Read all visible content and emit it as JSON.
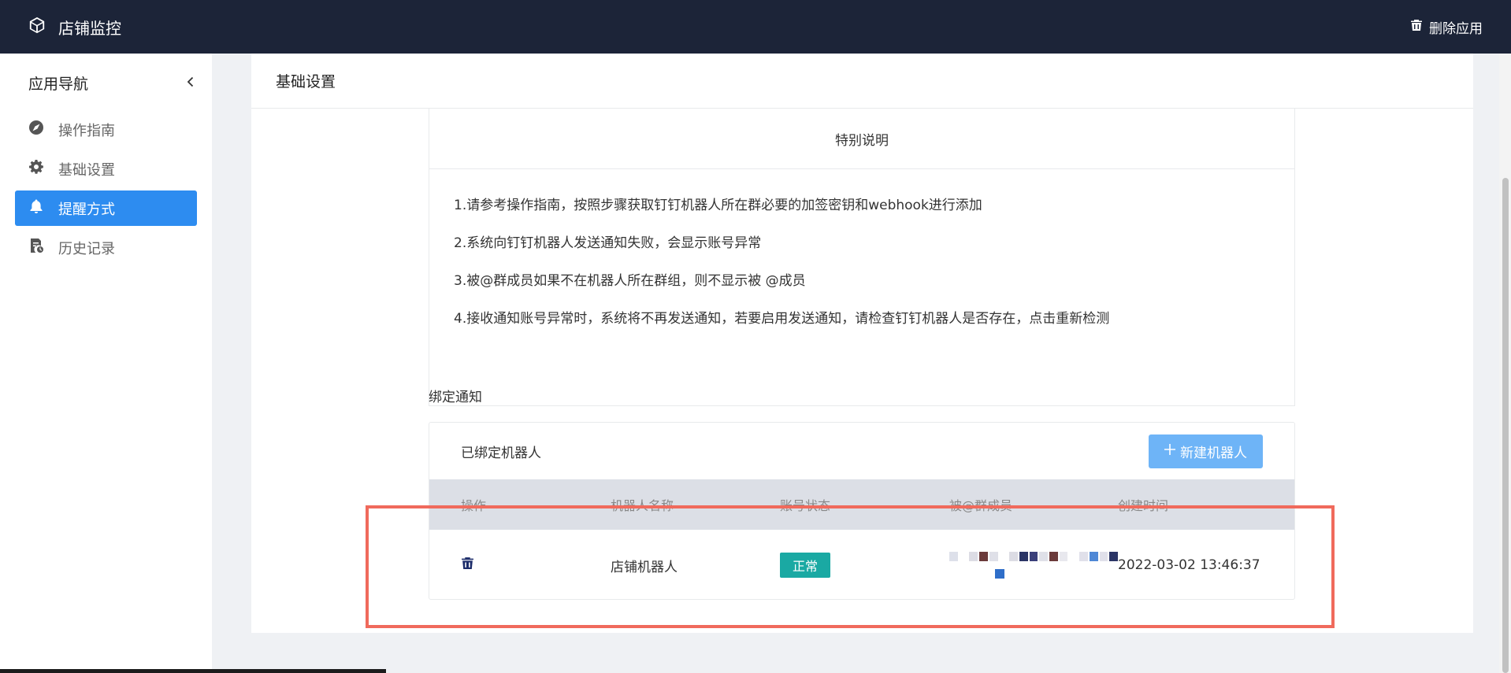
{
  "app": {
    "title": "店铺监控",
    "delete_label": "删除应用"
  },
  "sidebar": {
    "heading": "应用导航",
    "items": [
      {
        "label": "操作指南",
        "icon": "compass-icon"
      },
      {
        "label": "基础设置",
        "icon": "gear-icon"
      },
      {
        "label": "提醒方式",
        "icon": "bell-icon",
        "active": true
      },
      {
        "label": "历史记录",
        "icon": "history-doc-icon"
      }
    ]
  },
  "main": {
    "card_title": "基础设置",
    "notice": {
      "title": "特别说明",
      "lines": [
        "1.请参考操作指南，按照步骤获取钉钉机器人所在群必要的加签密钥和webhook进行添加",
        "2.系统向钉钉机器人发送通知失败，会显示账号异常",
        "3.被@群成员如果不在机器人所在群组，则不显示被 @成员",
        "4.接收通知账号异常时，系统将不再发送通知，若要启用发送通知，请检查钉钉机器人是否存在，点击重新检测"
      ]
    },
    "bind": {
      "label": "绑定通知",
      "box_title": "已绑定机器人",
      "new_button": "新建机器人",
      "columns": [
        "操作",
        "机器人名称",
        "账号状态",
        "被@群成员",
        "创建时间"
      ],
      "rows": [
        {
          "name": "店铺机器人",
          "status": "正常",
          "created": "2022-03-02 13:46:37"
        }
      ]
    }
  },
  "colors": {
    "topbar": "#1c2438",
    "accent": "#2d8cf0",
    "button_light": "#6eb4f7",
    "status_ok": "#1aa9a3",
    "highlight": "#f06a5c"
  }
}
